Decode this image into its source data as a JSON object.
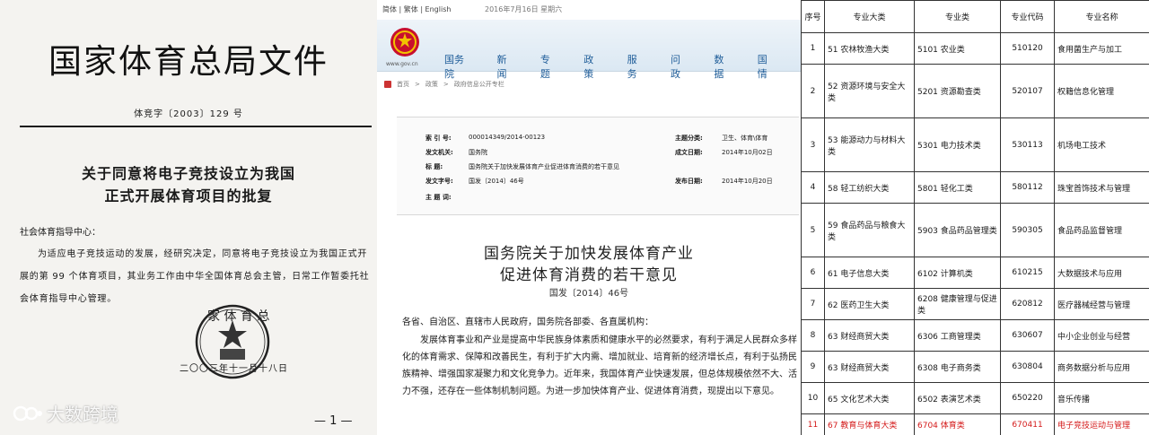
{
  "doc1": {
    "title": "国家体育总局文件",
    "doc_number": "体竞字〔2003〕129 号",
    "title_line1": "关于同意将电子竞技设立为我国",
    "title_line2": "正式开展体育项目的批复",
    "addressee": "社会体育指导中心：",
    "body": "为适应电子竞技运动的发展，经研究决定，同意将电子竞技设立为我国正式开展的第 99 个体育项目，其业务工作由中华全国体育总会主管，日常工作暂委托社会体育指导中心管理。",
    "seal_text": "家 体 育 总",
    "date": "二〇〇三年十一月十八日",
    "page_number": "— 1 —"
  },
  "watermark": {
    "text": "大数跨境",
    "logo": "K"
  },
  "doc2": {
    "language_links": "简体 | 繁体 | English",
    "date": "2016年7月16日 星期六",
    "site_url": "www.gov.cn",
    "nav": [
      "国务院",
      "新闻",
      "专题",
      "政策",
      "服务",
      "问政",
      "数据",
      "国情"
    ],
    "breadcrumb": [
      "首页",
      "政策",
      "政府信息公开专栏"
    ],
    "meta": {
      "index_label": "索 引 号:",
      "index_value": "000014349/2014-00123",
      "topic_label": "主题分类:",
      "topic_value": "卫生、体育\\体育",
      "issuer_label": "发文机关:",
      "issuer_value": "国务院",
      "created_label": "成文日期:",
      "created_value": "2014年10月02日",
      "title_label": "标    题:",
      "title_value": "国务院关于加快发展体育产业促进体育消费的若干意见",
      "docno_label": "发文字号:",
      "docno_value": "国发〔2014〕46号",
      "published_label": "发布日期:",
      "published_value": "2014年10月20日",
      "subject_label": "主 题 词:",
      "subject_value": ""
    },
    "title_line1": "国务院关于加快发展体育产业",
    "title_line2": "促进体育消费的若干意见",
    "doc_number": "国发〔2014〕46号",
    "addressee": "各省、自治区、直辖市人民政府，国务院各部委、各直属机构：",
    "body": "发展体育事业和产业是提高中华民族身体素质和健康水平的必然要求，有利于满足人民群众多样化的体育需求、保障和改善民生，有利于扩大内需、增加就业、培育新的经济增长点，有利于弘扬民族精神、增强国家凝聚力和文化竞争力。近年来，我国体育产业快速发展，但总体规模依然不大、活力不强，还存在一些体制机制问题。为进一步加快体育产业、促进体育消费，现提出以下意见。"
  },
  "doc3": {
    "headers": [
      "序号",
      "专业大类",
      "专业类",
      "专业代码",
      "专业名称"
    ],
    "rows": [
      {
        "no": "1",
        "category": "51 农林牧渔大类",
        "cls": "5101 农业类",
        "code": "510120",
        "name": "食用菌生产与加工"
      },
      {
        "no": "2",
        "category": "52 资源环境与安全大类",
        "cls": "5201 资源勘查类",
        "code": "520107",
        "name": "权籍信息化管理"
      },
      {
        "no": "3",
        "category": "53 能源动力与材料大类",
        "cls": "5301 电力技术类",
        "code": "530113",
        "name": "机场电工技术"
      },
      {
        "no": "4",
        "category": "58 轻工纺织大类",
        "cls": "5801 轻化工类",
        "code": "580112",
        "name": "珠宝首饰技术与管理"
      },
      {
        "no": "5",
        "category": "59 食品药品与粮食大类",
        "cls": "5903 食品药品管理类",
        "code": "590305",
        "name": "食品药品监督管理"
      },
      {
        "no": "6",
        "category": "61 电子信息大类",
        "cls": "6102 计算机类",
        "code": "610215",
        "name": "大数据技术与应用"
      },
      {
        "no": "7",
        "category": "62 医药卫生大类",
        "cls": "6208 健康管理与促进类",
        "code": "620812",
        "name": "医疗器械经营与管理"
      },
      {
        "no": "8",
        "category": "63 财经商贸大类",
        "cls": "6306 工商管理类",
        "code": "630607",
        "name": "中小企业创业与经营"
      },
      {
        "no": "9",
        "category": "63 财经商贸大类",
        "cls": "6308 电子商务类",
        "code": "630804",
        "name": "商务数据分析与应用"
      },
      {
        "no": "10",
        "category": "65 文化艺术大类",
        "cls": "6502 表演艺术类",
        "code": "650220",
        "name": "音乐传播"
      },
      {
        "no": "11",
        "category": "67 教育与体育大类",
        "cls": "6704 体育类",
        "code": "670411",
        "name": "电子竞技运动与管理"
      }
    ],
    "highlight_color": "#d41a1a"
  }
}
